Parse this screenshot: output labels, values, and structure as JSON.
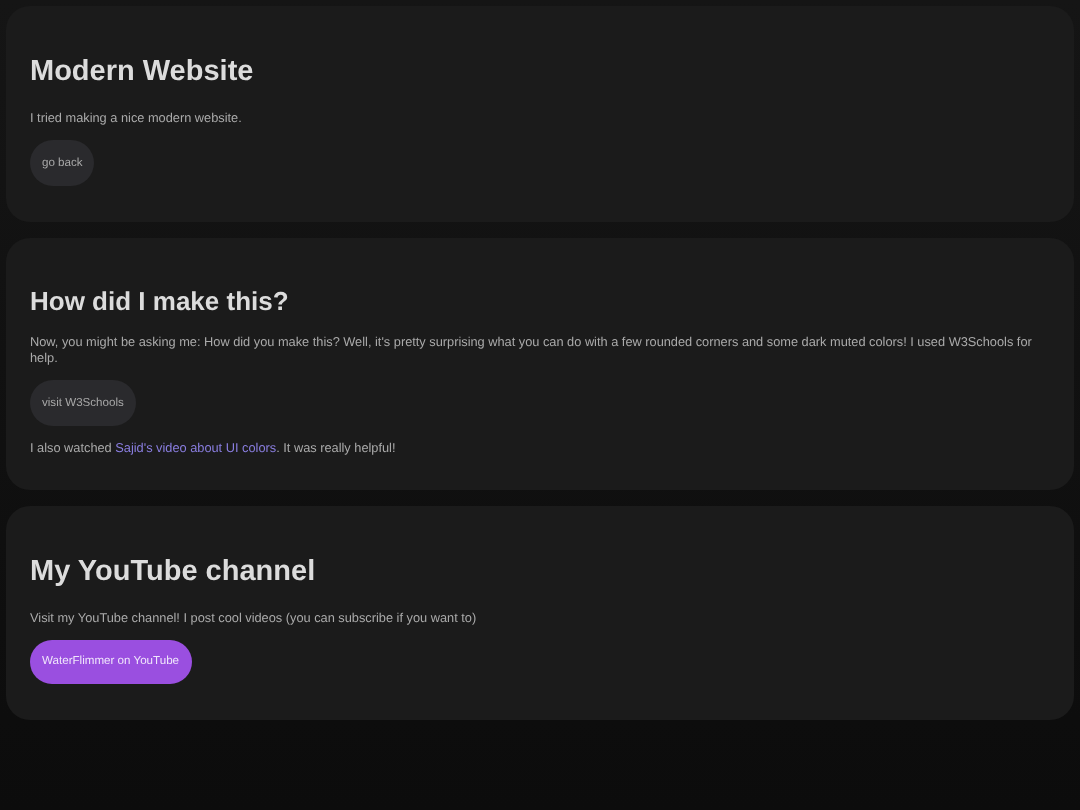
{
  "sections": [
    {
      "heading": "Modern Website",
      "large": true,
      "blocks": [
        {
          "kind": "text",
          "text": "I tried making a nice modern website."
        },
        {
          "kind": "button",
          "label": "go back"
        }
      ]
    },
    {
      "heading": "How did I make this?",
      "large": false,
      "blocks": [
        {
          "kind": "text",
          "text": "Now, you might be asking me: How did you make this? Well, it's pretty surprising what you can do with a few rounded corners and some dark muted colors! I used W3Schools for help."
        },
        {
          "kind": "button",
          "label": "visit W3Schools"
        },
        {
          "kind": "link_text",
          "before": "I also watched ",
          "link": "Sajid's video about UI colors",
          "after": ". It was really helpful!"
        }
      ]
    },
    {
      "heading": "My YouTube channel",
      "large": true,
      "blocks": [
        {
          "kind": "text",
          "text": "Visit my YouTube channel! I post cool videos (you can subscribe if you want to)"
        },
        {
          "kind": "accent_button",
          "label": "WaterFlimmer on YouTube"
        }
      ]
    }
  ]
}
